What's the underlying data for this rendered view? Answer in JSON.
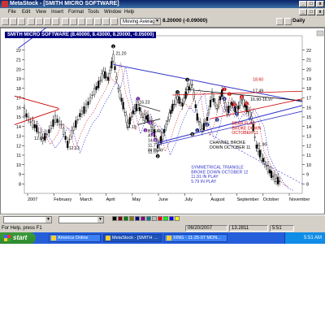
{
  "app": {
    "title": "MetaStock - [SMITH MICRO SOFTWARE]",
    "menu": [
      "File",
      "Edit",
      "View",
      "Insert",
      "Format",
      "Tools",
      "Window",
      "Help"
    ]
  },
  "toolbar": {
    "indicator_select": "Moving Average",
    "quote": "8.20000  (-0.09000)",
    "period": "Daily"
  },
  "chart_window": {
    "caption": "SMITH MICRO SOFTWARE (8.40000, 8.43000, 8.20000, -0.05000)"
  },
  "chart_data": {
    "type": "candlestick",
    "xlabel": "",
    "ylabel": "",
    "ylim": [
      7,
      23
    ],
    "yticks": [
      8,
      9,
      10,
      11,
      12,
      13,
      14,
      15,
      16,
      17,
      18,
      19,
      20,
      21,
      22
    ],
    "x_labels": [
      "2007",
      "February",
      "March",
      "April",
      "May",
      "June",
      "July",
      "August",
      "September",
      "October",
      "November"
    ],
    "price_path": [
      {
        "t": 0,
        "v": 15.5
      },
      {
        "t": 5,
        "v": 14.5
      },
      {
        "t": 10,
        "v": 13.8
      },
      {
        "t": 15,
        "v": 12.64
      },
      {
        "t": 20,
        "v": 13.5
      },
      {
        "t": 25,
        "v": 14.8
      },
      {
        "t": 30,
        "v": 14.2
      },
      {
        "t": 35,
        "v": 12.13
      },
      {
        "t": 40,
        "v": 13.8
      },
      {
        "t": 45,
        "v": 15.2
      },
      {
        "t": 50,
        "v": 16.0
      },
      {
        "t": 55,
        "v": 17.3
      },
      {
        "t": 60,
        "v": 18.4
      },
      {
        "t": 64,
        "v": 19.6
      },
      {
        "t": 68,
        "v": 19.0
      },
      {
        "t": 72,
        "v": 21.2
      },
      {
        "t": 76,
        "v": 18.0
      },
      {
        "t": 80,
        "v": 16.2
      },
      {
        "t": 84,
        "v": 14.13
      },
      {
        "t": 88,
        "v": 15.5
      },
      {
        "t": 92,
        "v": 16.23
      },
      {
        "t": 96,
        "v": 15.0
      },
      {
        "t": 100,
        "v": 14.89
      },
      {
        "t": 104,
        "v": 14.0
      },
      {
        "t": 108,
        "v": 11.91
      },
      {
        "t": 112,
        "v": 13.0
      },
      {
        "t": 116,
        "v": 14.6
      },
      {
        "t": 120,
        "v": 16.0
      },
      {
        "t": 124,
        "v": 17.0
      },
      {
        "t": 128,
        "v": 16.3
      },
      {
        "t": 132,
        "v": 17.8
      },
      {
        "t": 136,
        "v": 18.4
      },
      {
        "t": 140,
        "v": 15.0
      },
      {
        "t": 144,
        "v": 13.6
      },
      {
        "t": 148,
        "v": 14.8
      },
      {
        "t": 152,
        "v": 17.2
      },
      {
        "t": 156,
        "v": 15.9
      },
      {
        "t": 160,
        "v": 17.49
      },
      {
        "t": 164,
        "v": 15.5
      },
      {
        "t": 168,
        "v": 16.4
      },
      {
        "t": 172,
        "v": 15.6
      },
      {
        "t": 176,
        "v": 16.8
      },
      {
        "t": 180,
        "v": 15.9
      },
      {
        "t": 184,
        "v": 14.9
      },
      {
        "t": 188,
        "v": 11.9
      },
      {
        "t": 192,
        "v": 10.8
      },
      {
        "t": 196,
        "v": 9.9
      },
      {
        "t": 200,
        "v": 9.0
      },
      {
        "t": 204,
        "v": 8.4
      },
      {
        "t": 208,
        "v": 8.2
      }
    ],
    "annotations": [
      {
        "text": "21.20",
        "color": "#000000"
      },
      {
        "text": "12.64",
        "color": "#000000"
      },
      {
        "text": "12.13",
        "color": "#000000"
      },
      {
        "text": "14.13",
        "color": "#000000"
      },
      {
        "text": "16.23",
        "color": "#000000"
      },
      {
        "text": "BREAK",
        "color": "#000000"
      },
      {
        "text": "AT",
        "color": "#000000"
      },
      {
        "text": "14.89",
        "color": "#000000"
      },
      {
        "text": "11.77",
        "color": "#000000"
      },
      {
        "text": "IN PLAY",
        "color": "#000000"
      },
      {
        "text": "11.91",
        "color": "#000000"
      },
      {
        "text": "18.60",
        "color": "#cc0000"
      },
      {
        "text": "17.49",
        "color": "#000000"
      },
      {
        "text": "16.90-16.97",
        "color": "#000000"
      },
      {
        "text": "BEAR FLAG",
        "color": "#cc0000"
      },
      {
        "text": "BROKE DOWN",
        "color": "#cc0000"
      },
      {
        "text": "OCTOBER 11",
        "color": "#cc0000"
      },
      {
        "text": "CHANNEL BROKE",
        "color": "#000000"
      },
      {
        "text": "DOWN OCTOBER 11",
        "color": "#000000"
      },
      {
        "text": "11.90",
        "color": "#000000"
      },
      {
        "text": "SYMMETRICAL TRIANGLE",
        "color": "#3333cc"
      },
      {
        "text": "BROKE DOWN OCTOBER 12",
        "color": "#3333cc"
      },
      {
        "text": "11.91 IN PLAY",
        "color": "#3333cc"
      },
      {
        "text": "5.79 IN PLAY",
        "color": "#3333cc"
      }
    ],
    "wave_markers": [
      "1",
      "2",
      "3",
      "4",
      "5",
      "1",
      "2",
      "3",
      "4",
      "5",
      "1",
      "2",
      "3",
      "4",
      "5",
      "1",
      "2",
      "3",
      "4",
      "5"
    ]
  },
  "status": {
    "help": "For Help, press F1",
    "date": "06/20/2007",
    "value": "13.2811",
    "time": "5:51"
  },
  "taskbar": {
    "start": "start",
    "tasks": [
      "America Online",
      "MetaStock - [SMITH ...",
      "XING - 11-25-07 MON..."
    ],
    "clock": "5:51 AM"
  },
  "colors": {
    "title_bar": "#0a246a",
    "taskbar": "#245edb",
    "start_button": "#3c9a3c",
    "channel_lines": "#3333cc",
    "triangle_lines": "#cc0000"
  }
}
